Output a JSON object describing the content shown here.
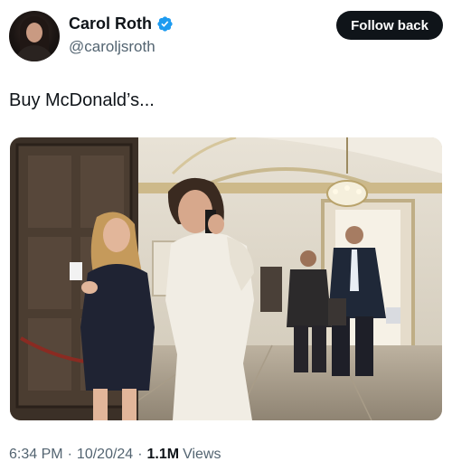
{
  "author": {
    "name": "Carol Roth",
    "handle": "@caroljsroth",
    "verified_color": "#1d9bf0"
  },
  "follow_button": {
    "label": "Follow back"
  },
  "tweet": {
    "text": "Buy McDonald’s...",
    "photo_icon": "photo-image"
  },
  "meta": {
    "time": "6:34 PM",
    "separator": "·",
    "date": "10/20/24",
    "views_count": "1.1M",
    "views_label": "Views"
  },
  "colors": {
    "text_primary": "#0f1419",
    "text_secondary": "#536471",
    "button_bg": "#0f1419"
  }
}
